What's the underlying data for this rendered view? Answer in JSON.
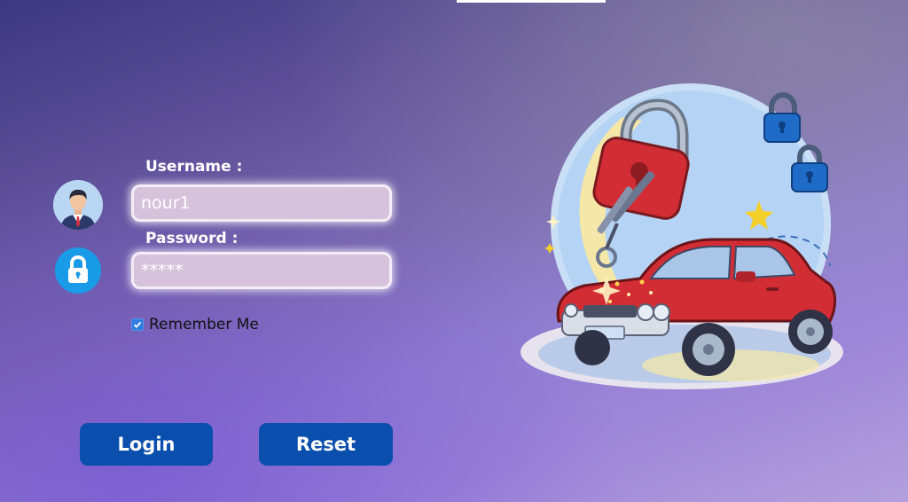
{
  "form": {
    "username_label": "Username :",
    "username_value": "nour1",
    "password_label": "Password :",
    "password_placeholder": "*****",
    "remember_label": "Remember Me",
    "remember_checked": true
  },
  "buttons": {
    "login_label": "Login",
    "reset_label": "Reset"
  },
  "icons": {
    "user": "user-avatar-icon",
    "lock": "lock-icon",
    "illustration": "car-keys-padlock-illustration"
  },
  "colors": {
    "button_bg": "#0b4fae",
    "field_bg": "#d6c2da",
    "checkbox": "#2f7de1",
    "lock_icon_bg": "#1a9be8",
    "user_icon_bg": "#aecdee"
  }
}
